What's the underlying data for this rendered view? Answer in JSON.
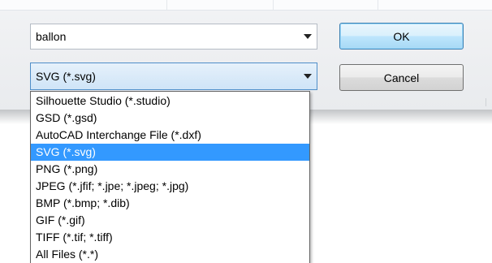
{
  "dialog": {
    "file_name_value": "ballon",
    "file_type_value": "SVG (*.svg)",
    "ok_label": "OK",
    "cancel_label": "Cancel"
  },
  "file_type_options": [
    {
      "label": "Silhouette Studio (*.studio)",
      "selected": false
    },
    {
      "label": "GSD (*.gsd)",
      "selected": false
    },
    {
      "label": "AutoCAD Interchange File (*.dxf)",
      "selected": false
    },
    {
      "label": "SVG (*.svg)",
      "selected": true
    },
    {
      "label": "PNG (*.png)",
      "selected": false
    },
    {
      "label": "JPEG (*.jfif; *.jpe; *.jpeg; *.jpg)",
      "selected": false
    },
    {
      "label": "BMP (*.bmp; *.dib)",
      "selected": false
    },
    {
      "label": "GIF (*.gif)",
      "selected": false
    },
    {
      "label": "TIFF (*.tif; *.tiff)",
      "selected": false
    },
    {
      "label": "All Files (*.*)",
      "selected": false
    }
  ],
  "icons": {
    "combo_arrow": "chevron-down-icon"
  },
  "colors": {
    "selection": "#3399ff",
    "focus_border": "#4f8ec8",
    "default_button_border": "#3c7fb1"
  }
}
